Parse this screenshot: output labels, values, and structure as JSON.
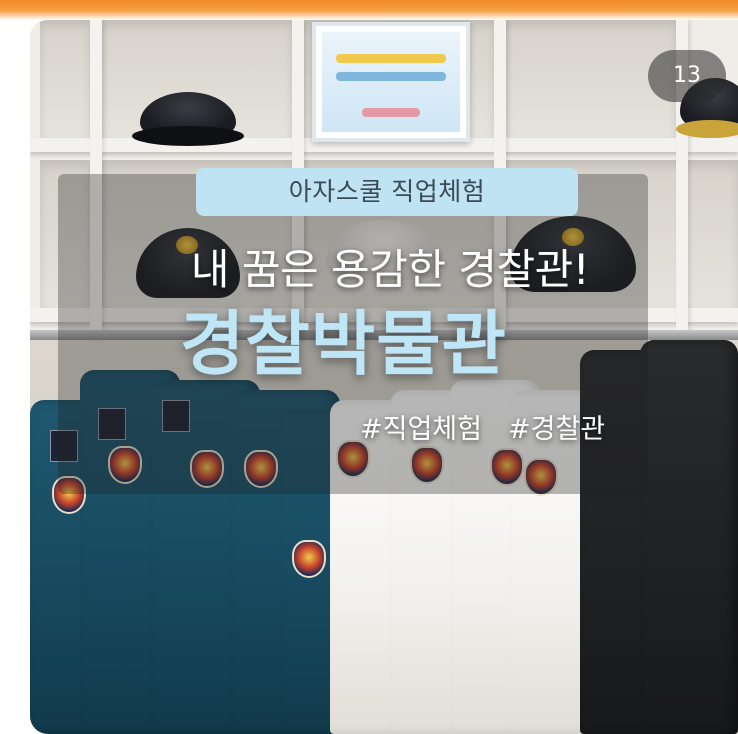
{
  "post": {
    "image_count": "13",
    "category_label": "아자스쿨 직업체험",
    "subtitle": "내 꿈은 용감한 경찰관!",
    "title": "경찰박물관",
    "hashtags": [
      "#직업체험",
      "#경찰관"
    ]
  },
  "colors": {
    "accent_orange": "#f08a24",
    "pill_background": "#bfe3f3",
    "title_color": "#bfe6f7"
  },
  "photo": {
    "subject": "police uniforms and caps on display shelves and clothing rack"
  }
}
